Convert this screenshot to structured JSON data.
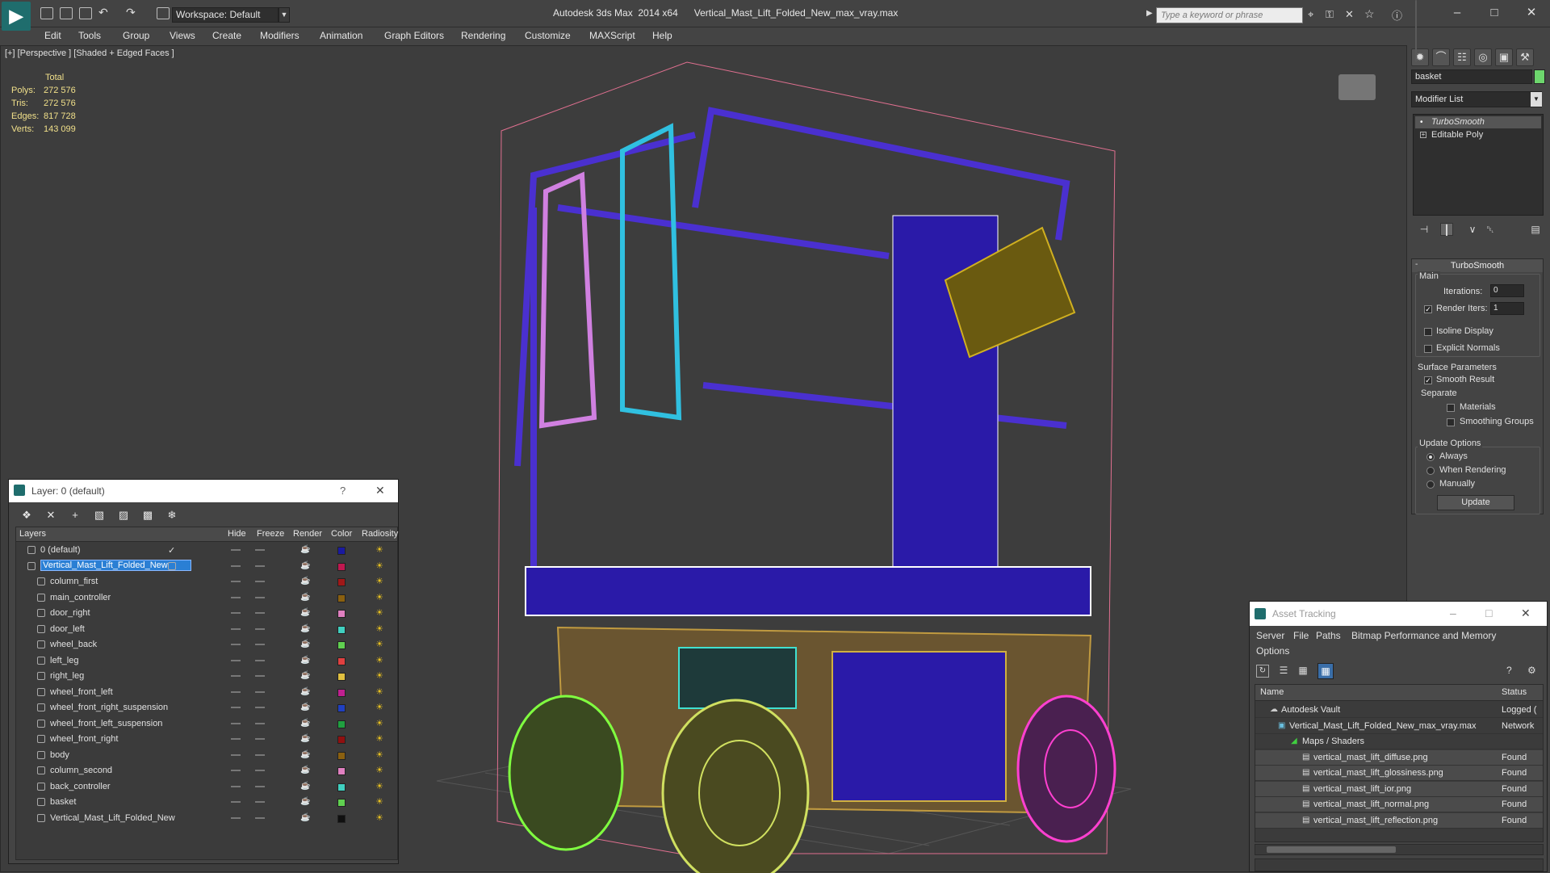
{
  "titlebar": {
    "workspace": "Workspace: Default",
    "title": "Autodesk 3ds Max  2014 x64      Vertical_Mast_Lift_Folded_New_max_vray.max",
    "search_placeholder": "Type a keyword or phrase"
  },
  "menu": [
    "Edit",
    "Tools",
    "Group",
    "Views",
    "Create",
    "Modifiers",
    "Animation",
    "Graph Editors",
    "Rendering",
    "Customize",
    "MAXScript",
    "Help"
  ],
  "viewport": {
    "label": "[+] [Perspective ] [Shaded + Edged Faces ]",
    "stats": {
      "header": "Total",
      "rows": [
        {
          "label": "Polys:",
          "value": "272 576"
        },
        {
          "label": "Tris:",
          "value": "272 576"
        },
        {
          "label": "Edges:",
          "value": "817 728"
        },
        {
          "label": "Verts:",
          "value": "143 099"
        }
      ]
    }
  },
  "command_panel": {
    "object_name": "basket",
    "modifier_list": "Modifier List",
    "stack": [
      "TurboSmooth",
      "Editable Poly"
    ],
    "turbosmooth": {
      "header": "TurboSmooth",
      "main": "Main",
      "iterations_label": "Iterations:",
      "iterations": "0",
      "render_iters_label": "Render Iters:",
      "render_iters": "1",
      "isoline": "Isoline Display",
      "explicit_normals": "Explicit Normals",
      "surface_params": "Surface Parameters",
      "smooth_result": "Smooth Result",
      "separate": "Separate",
      "materials": "Materials",
      "smoothing_groups": "Smoothing Groups",
      "update_options": "Update Options",
      "always": "Always",
      "when_rendering": "When Rendering",
      "manually": "Manually",
      "update_btn": "Update"
    }
  },
  "layers": {
    "title": "Layer: 0 (default)",
    "columns": [
      "Layers",
      "Hide",
      "Freeze",
      "Render",
      "Color",
      "Radiosity"
    ],
    "rows": [
      {
        "name": "0 (default)",
        "color": "#1a1aa0",
        "level": 0
      },
      {
        "name": "Vertical_Mast_Lift_Folded_New",
        "color": "#c01850",
        "level": 0,
        "selected": true
      },
      {
        "name": "column_first",
        "color": "#a01818",
        "level": 1
      },
      {
        "name": "main_controller",
        "color": "#8a6010",
        "level": 1
      },
      {
        "name": "door_right",
        "color": "#e080c0",
        "level": 1
      },
      {
        "name": "door_left",
        "color": "#40d0c0",
        "level": 1
      },
      {
        "name": "wheel_back",
        "color": "#60d050",
        "level": 1
      },
      {
        "name": "left_leg",
        "color": "#e04040",
        "level": 1
      },
      {
        "name": "right_leg",
        "color": "#e0c040",
        "level": 1
      },
      {
        "name": "wheel_front_left",
        "color": "#c02090",
        "level": 1
      },
      {
        "name": "wheel_front_right_suspension",
        "color": "#2040c0",
        "level": 1
      },
      {
        "name": "wheel_front_left_suspension",
        "color": "#20a040",
        "level": 1
      },
      {
        "name": "wheel_front_right",
        "color": "#901010",
        "level": 1
      },
      {
        "name": "body",
        "color": "#8a6010",
        "level": 1
      },
      {
        "name": "column_second",
        "color": "#e080c0",
        "level": 1
      },
      {
        "name": "back_controller",
        "color": "#40d0c0",
        "level": 1
      },
      {
        "name": "basket",
        "color": "#60d050",
        "level": 1
      },
      {
        "name": "Vertical_Mast_Lift_Folded_New",
        "color": "#101010",
        "level": 1
      }
    ]
  },
  "asset_tracking": {
    "title": "Asset Tracking",
    "menu": [
      "Server",
      "File",
      "Paths",
      "Bitmap Performance and Memory",
      "Options"
    ],
    "columns": [
      "Name",
      "Status"
    ],
    "rows": [
      {
        "name": "Autodesk Vault",
        "status": "Logged (",
        "indent": 0
      },
      {
        "name": "Vertical_Mast_Lift_Folded_New_max_vray.max",
        "status": "Network",
        "indent": 1
      },
      {
        "name": "Maps / Shaders",
        "status": "",
        "indent": 2
      },
      {
        "name": "vertical_mast_lift_diffuse.png",
        "status": "Found",
        "indent": 3
      },
      {
        "name": "vertical_mast_lift_glossiness.png",
        "status": "Found",
        "indent": 3
      },
      {
        "name": "vertical_mast_lift_ior.png",
        "status": "Found",
        "indent": 3
      },
      {
        "name": "vertical_mast_lift_normal.png",
        "status": "Found",
        "indent": 3
      },
      {
        "name": "vertical_mast_lift_reflection.png",
        "status": "Found",
        "indent": 3
      }
    ]
  }
}
